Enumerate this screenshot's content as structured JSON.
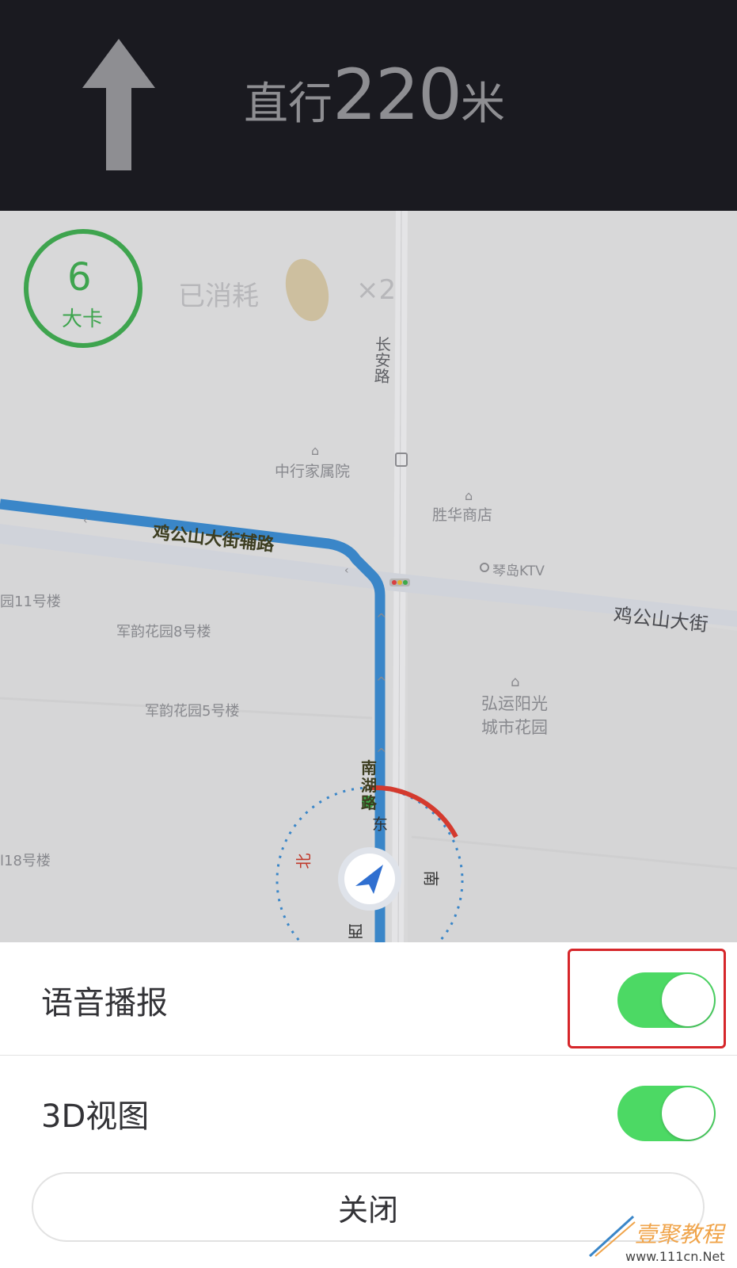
{
  "navigation": {
    "maneuver_icon": "straight-arrow-icon",
    "instruction_prefix": "直行",
    "distance_value": "220",
    "distance_unit": "米"
  },
  "calories": {
    "value": "6",
    "unit": "大卡",
    "consumed_label": "已消耗",
    "food_icon": "peanut-icon",
    "multiplier": "×2"
  },
  "map": {
    "road_labels": [
      "长安路",
      "鸡公山大街辅路",
      "鸡公山大街",
      "南湖路"
    ],
    "poi_labels": [
      "中行家属院",
      "胜华商店",
      "琴岛KTV",
      "园11号楼",
      "军韵花园8号楼",
      "军韵花园5号楼",
      "弘运阳光",
      "城市花园",
      "l18号楼"
    ],
    "compass": {
      "north": "北",
      "east": "东",
      "south": "南",
      "west": "西"
    }
  },
  "settings": {
    "voice_broadcast": {
      "label": "语音播报",
      "enabled": true
    },
    "view_3d": {
      "label": "3D视图",
      "enabled": true
    },
    "close_label": "关闭"
  },
  "watermark": {
    "brand": "壹聚教程",
    "url": "www.111cn.Net"
  },
  "colors": {
    "header_bg": "#1a1a20",
    "toggle_on": "#4cd964",
    "route_blue": "#3a86c8",
    "highlight": "#d6262a",
    "calorie_ring": "#3ea44e"
  }
}
